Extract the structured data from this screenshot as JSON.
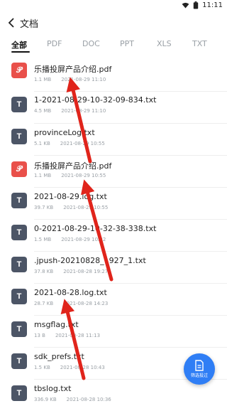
{
  "status_bar": {
    "time": "11:11"
  },
  "header": {
    "title": "文档"
  },
  "tabs": [
    {
      "label": "全部",
      "active": true
    },
    {
      "label": "PDF"
    },
    {
      "label": "DOC"
    },
    {
      "label": "PPT"
    },
    {
      "label": "XLS"
    },
    {
      "label": "TXT"
    }
  ],
  "files": [
    {
      "type": "pdf",
      "icon": "pdf-icon",
      "name": "乐播投屏产品介绍.pdf",
      "size": "1.1 MB",
      "date": "2021-08-29 11:10"
    },
    {
      "type": "txt",
      "icon": "txt-icon",
      "name": "1-2021-08-29-10-32-09-834.txt",
      "size": "4.5 MB",
      "date": "2021-08-29 11:10"
    },
    {
      "type": "txt",
      "icon": "txt-icon",
      "name": "provinceLog.txt",
      "size": "5.1 KB",
      "date": "2021-08-29 10:55"
    },
    {
      "type": "pdf",
      "icon": "pdf-icon",
      "name": "乐播投屏产品介绍.pdf",
      "size": "1.1 MB",
      "date": "2021-08-29 10:55"
    },
    {
      "type": "txt",
      "icon": "txt-icon",
      "name": "2021-08-29.log.txt",
      "size": "39.7 KB",
      "date": "2021-08-29 10:55"
    },
    {
      "type": "txt",
      "icon": "txt-icon",
      "name": "0-2021-08-29-10-32-38-338.txt",
      "size": "1.5 MB",
      "date": "2021-08-29 10:32"
    },
    {
      "type": "txt",
      "icon": "txt-icon",
      "name": ".jpush-20210828_1927_1.txt",
      "size": "37.8 KB",
      "date": "2021-08-28 19:27"
    },
    {
      "type": "txt",
      "icon": "txt-icon",
      "name": "2021-08-28.log.txt",
      "size": "28.7 KB",
      "date": "2021-08-28 14:23"
    },
    {
      "type": "txt",
      "icon": "txt-icon",
      "name": "msgflag.txt",
      "size": "13 B",
      "date": "2021-08-28 11:13"
    },
    {
      "type": "txt",
      "icon": "txt-icon",
      "name": "sdk_prefs.txt",
      "size": "1.5 KB",
      "date": "2021-08-28 10:43"
    },
    {
      "type": "txt",
      "icon": "txt-icon",
      "name": "tbslog.txt",
      "size": "336.9 KB",
      "date": "2021-08-28 10:36"
    }
  ],
  "fab": {
    "label": "筛选投过",
    "icon": "document-icon"
  },
  "annotation": {
    "color": "#e0241b"
  },
  "colors": {
    "accent": "#2f7ef5",
    "pdf": "#e9504a",
    "txt": "#4c5566"
  }
}
